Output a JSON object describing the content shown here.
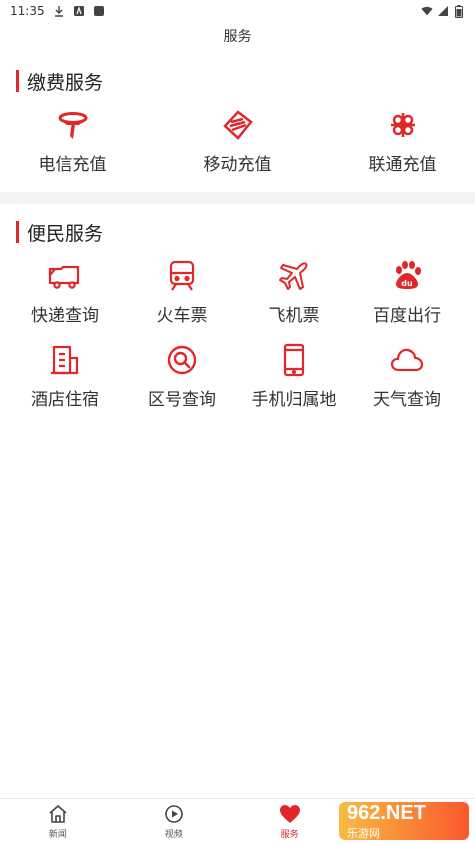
{
  "status_bar": {
    "time": "11:35"
  },
  "header": {
    "title": "服务"
  },
  "payment_section": {
    "title": "缴费服务",
    "items": [
      {
        "label": "电信充值",
        "icon": "china-telecom-icon"
      },
      {
        "label": "移动充值",
        "icon": "china-mobile-icon"
      },
      {
        "label": "联通充值",
        "icon": "china-unicom-icon"
      }
    ]
  },
  "convenience_section": {
    "title": "便民服务",
    "items": [
      {
        "label": "快递查询",
        "icon": "truck-icon"
      },
      {
        "label": "火车票",
        "icon": "train-icon"
      },
      {
        "label": "飞机票",
        "icon": "airplane-icon"
      },
      {
        "label": "百度出行",
        "icon": "baidu-icon"
      },
      {
        "label": "酒店住宿",
        "icon": "hotel-icon"
      },
      {
        "label": "区号查询",
        "icon": "magnifier-icon"
      },
      {
        "label": "手机归属地",
        "icon": "phone-icon"
      },
      {
        "label": "天气查询",
        "icon": "cloud-icon"
      }
    ]
  },
  "tabs": [
    {
      "label": "新闻",
      "icon": "home-icon"
    },
    {
      "label": "视频",
      "icon": "play-icon"
    },
    {
      "label": "服务",
      "icon": "heart-icon",
      "active": true
    }
  ],
  "watermark": {
    "text": "962.NET",
    "sub": "乐游网"
  },
  "colors": {
    "accent": "#e0282b",
    "section_gap": "#f3f3f3"
  }
}
